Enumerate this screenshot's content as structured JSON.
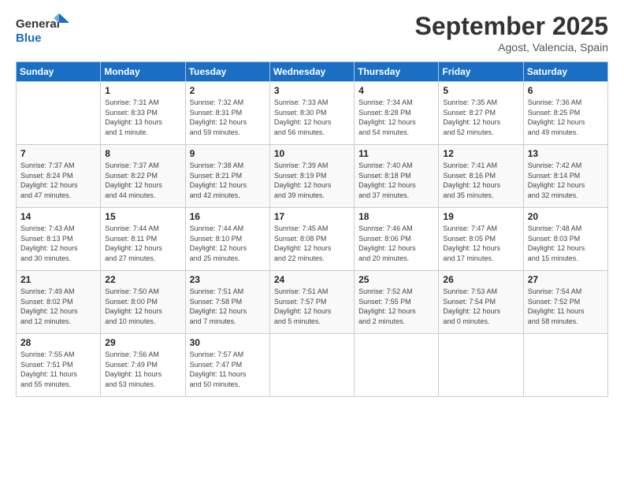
{
  "logo": {
    "line1": "General",
    "line2": "Blue"
  },
  "title": "September 2025",
  "subtitle": "Agost, Valencia, Spain",
  "days_of_week": [
    "Sunday",
    "Monday",
    "Tuesday",
    "Wednesday",
    "Thursday",
    "Friday",
    "Saturday"
  ],
  "weeks": [
    [
      {
        "day": "",
        "info": ""
      },
      {
        "day": "1",
        "info": "Sunrise: 7:31 AM\nSunset: 8:33 PM\nDaylight: 13 hours\nand 1 minute."
      },
      {
        "day": "2",
        "info": "Sunrise: 7:32 AM\nSunset: 8:31 PM\nDaylight: 12 hours\nand 59 minutes."
      },
      {
        "day": "3",
        "info": "Sunrise: 7:33 AM\nSunset: 8:30 PM\nDaylight: 12 hours\nand 56 minutes."
      },
      {
        "day": "4",
        "info": "Sunrise: 7:34 AM\nSunset: 8:28 PM\nDaylight: 12 hours\nand 54 minutes."
      },
      {
        "day": "5",
        "info": "Sunrise: 7:35 AM\nSunset: 8:27 PM\nDaylight: 12 hours\nand 52 minutes."
      },
      {
        "day": "6",
        "info": "Sunrise: 7:36 AM\nSunset: 8:25 PM\nDaylight: 12 hours\nand 49 minutes."
      }
    ],
    [
      {
        "day": "7",
        "info": "Sunrise: 7:37 AM\nSunset: 8:24 PM\nDaylight: 12 hours\nand 47 minutes."
      },
      {
        "day": "8",
        "info": "Sunrise: 7:37 AM\nSunset: 8:22 PM\nDaylight: 12 hours\nand 44 minutes."
      },
      {
        "day": "9",
        "info": "Sunrise: 7:38 AM\nSunset: 8:21 PM\nDaylight: 12 hours\nand 42 minutes."
      },
      {
        "day": "10",
        "info": "Sunrise: 7:39 AM\nSunset: 8:19 PM\nDaylight: 12 hours\nand 39 minutes."
      },
      {
        "day": "11",
        "info": "Sunrise: 7:40 AM\nSunset: 8:18 PM\nDaylight: 12 hours\nand 37 minutes."
      },
      {
        "day": "12",
        "info": "Sunrise: 7:41 AM\nSunset: 8:16 PM\nDaylight: 12 hours\nand 35 minutes."
      },
      {
        "day": "13",
        "info": "Sunrise: 7:42 AM\nSunset: 8:14 PM\nDaylight: 12 hours\nand 32 minutes."
      }
    ],
    [
      {
        "day": "14",
        "info": "Sunrise: 7:43 AM\nSunset: 8:13 PM\nDaylight: 12 hours\nand 30 minutes."
      },
      {
        "day": "15",
        "info": "Sunrise: 7:44 AM\nSunset: 8:11 PM\nDaylight: 12 hours\nand 27 minutes."
      },
      {
        "day": "16",
        "info": "Sunrise: 7:44 AM\nSunset: 8:10 PM\nDaylight: 12 hours\nand 25 minutes."
      },
      {
        "day": "17",
        "info": "Sunrise: 7:45 AM\nSunset: 8:08 PM\nDaylight: 12 hours\nand 22 minutes."
      },
      {
        "day": "18",
        "info": "Sunrise: 7:46 AM\nSunset: 8:06 PM\nDaylight: 12 hours\nand 20 minutes."
      },
      {
        "day": "19",
        "info": "Sunrise: 7:47 AM\nSunset: 8:05 PM\nDaylight: 12 hours\nand 17 minutes."
      },
      {
        "day": "20",
        "info": "Sunrise: 7:48 AM\nSunset: 8:03 PM\nDaylight: 12 hours\nand 15 minutes."
      }
    ],
    [
      {
        "day": "21",
        "info": "Sunrise: 7:49 AM\nSunset: 8:02 PM\nDaylight: 12 hours\nand 12 minutes."
      },
      {
        "day": "22",
        "info": "Sunrise: 7:50 AM\nSunset: 8:00 PM\nDaylight: 12 hours\nand 10 minutes."
      },
      {
        "day": "23",
        "info": "Sunrise: 7:51 AM\nSunset: 7:58 PM\nDaylight: 12 hours\nand 7 minutes."
      },
      {
        "day": "24",
        "info": "Sunrise: 7:51 AM\nSunset: 7:57 PM\nDaylight: 12 hours\nand 5 minutes."
      },
      {
        "day": "25",
        "info": "Sunrise: 7:52 AM\nSunset: 7:55 PM\nDaylight: 12 hours\nand 2 minutes."
      },
      {
        "day": "26",
        "info": "Sunrise: 7:53 AM\nSunset: 7:54 PM\nDaylight: 12 hours\nand 0 minutes."
      },
      {
        "day": "27",
        "info": "Sunrise: 7:54 AM\nSunset: 7:52 PM\nDaylight: 11 hours\nand 58 minutes."
      }
    ],
    [
      {
        "day": "28",
        "info": "Sunrise: 7:55 AM\nSunset: 7:51 PM\nDaylight: 11 hours\nand 55 minutes."
      },
      {
        "day": "29",
        "info": "Sunrise: 7:56 AM\nSunset: 7:49 PM\nDaylight: 11 hours\nand 53 minutes."
      },
      {
        "day": "30",
        "info": "Sunrise: 7:57 AM\nSunset: 7:47 PM\nDaylight: 11 hours\nand 50 minutes."
      },
      {
        "day": "",
        "info": ""
      },
      {
        "day": "",
        "info": ""
      },
      {
        "day": "",
        "info": ""
      },
      {
        "day": "",
        "info": ""
      }
    ]
  ]
}
